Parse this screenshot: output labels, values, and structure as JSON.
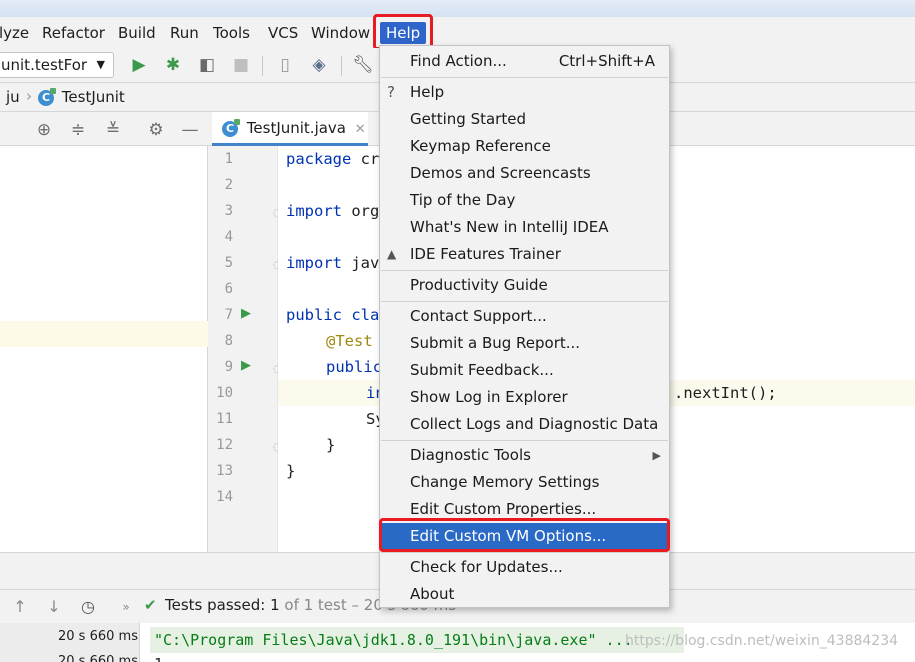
{
  "menubar": {
    "items": [
      "lyze",
      "Refactor",
      "Build",
      "Run",
      "Tools",
      "VCS",
      "Window",
      "Help"
    ]
  },
  "toolbar": {
    "run_config": "unit.testFor"
  },
  "navbar": {
    "crumb1": "ju",
    "crumb2": "TestJunit"
  },
  "editor": {
    "tab_label": "TestJunit.java",
    "line_numbers": [
      "1",
      "2",
      "3",
      "4",
      "5",
      "6",
      "7",
      "8",
      "9",
      "10",
      "11",
      "12",
      "13",
      "14"
    ],
    "lines": {
      "l1_kw": "package",
      "l1_rest": " cr",
      "l3_kw": "import",
      "l3_rest": " org",
      "l5_kw": "import",
      "l5_rest": " jav",
      "l7_kw": "public",
      "l7_rest": " cla",
      "l8": "@Test",
      "l9": "public",
      "l10_a": "in",
      "l10_b": ".nextInt();",
      "l11": "Sy",
      "l12": "}",
      "l13": "}"
    }
  },
  "help_menu": {
    "find_action": "Find Action...",
    "find_action_shortcut": "Ctrl+Shift+A",
    "help": "Help",
    "getting_started": "Getting Started",
    "keymap_reference": "Keymap Reference",
    "demos": "Demos and Screencasts",
    "tip_of_day": "Tip of the Day",
    "whats_new": "What's New in IntelliJ IDEA",
    "features_trainer": "IDE Features Trainer",
    "productivity_guide": "Productivity Guide",
    "contact_support": "Contact Support...",
    "submit_bug": "Submit a Bug Report...",
    "submit_feedback": "Submit Feedback...",
    "show_log": "Show Log in Explorer",
    "collect_logs": "Collect Logs and Diagnostic Data",
    "diagnostic_tools": "Diagnostic Tools",
    "change_memory": "Change Memory Settings",
    "edit_custom_properties": "Edit Custom Properties...",
    "edit_custom_vm": "Edit Custom VM Options...",
    "check_updates": "Check for Updates...",
    "about": "About"
  },
  "test_bar": {
    "status_prefix": "Tests passed:",
    "status_count": "1",
    "status_rest": "of 1 test – 20 s 660 ms"
  },
  "console": {
    "duration1": "20 s 660 ms",
    "duration2": "20 s 660 ms",
    "command": "\"C:\\Program Files\\Java\\jdk1.8.0_191\\bin\\java.exe\" ...",
    "output_line": "1",
    "watermark": "https://blog.csdn.net/weixin_43884234"
  },
  "colors": {
    "menu_highlight": "#2f65ca",
    "annotation_red": "#e81b23",
    "selected_item": "#2a6ac7"
  }
}
